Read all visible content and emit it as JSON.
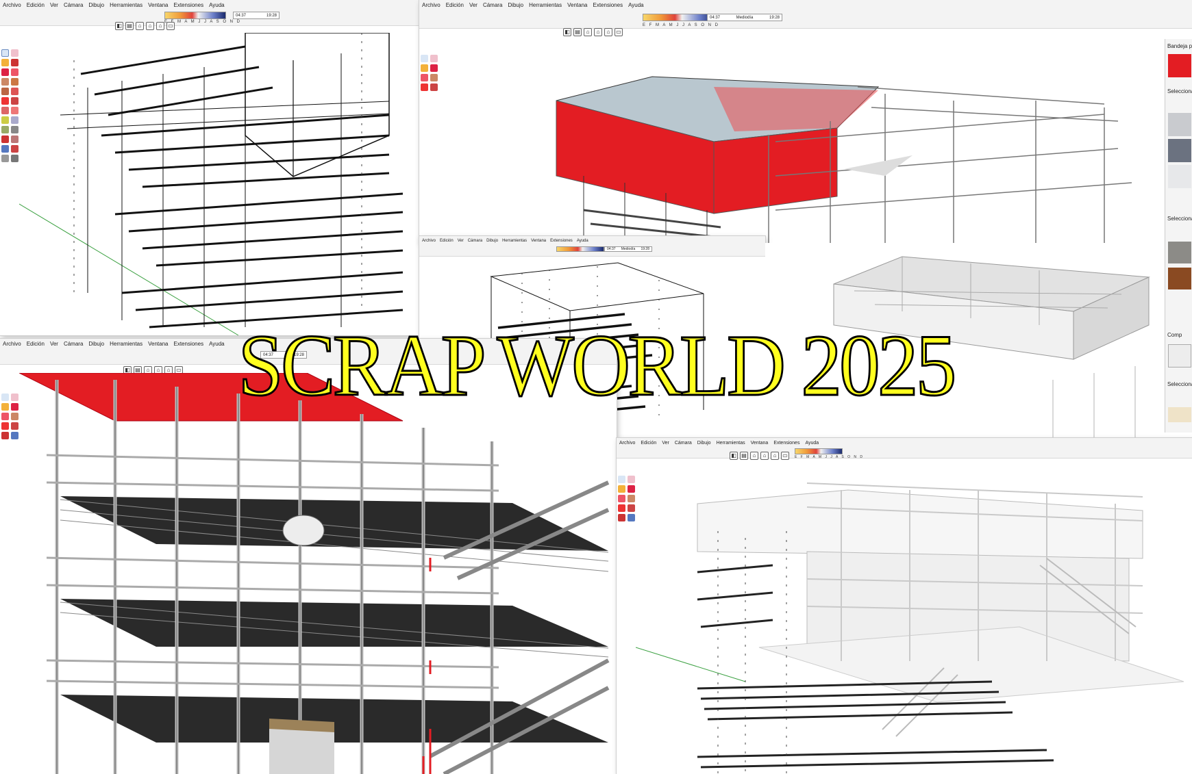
{
  "menu": [
    "Archivo",
    "Edición",
    "Ver",
    "Cámara",
    "Dibujo",
    "Herramientas",
    "Ventana",
    "Extensiones",
    "Ayuda"
  ],
  "shadow": {
    "months": "E F M A M J J A S O N D",
    "time_start": "04:37",
    "time_mid": "Mediodía",
    "time_end": "19:28",
    "time_mid_short": "Mediodía"
  },
  "tray": {
    "panel_title": "Bandeja pr",
    "section_1": "Selecciona",
    "section_2": "Selecciona",
    "section_3": "Comp",
    "section_4": "Selecciona"
  },
  "title": "SCRAP WORLD 2025",
  "colors": {
    "accent_red": "#e31d23",
    "title_fill": "#ffff1f",
    "title_stroke": "#000000",
    "axis_green": "#3aa040"
  },
  "icons": [
    "select-arrow-icon",
    "eraser-icon",
    "pencil-icon",
    "paint-bucket-icon",
    "orbit-icon",
    "pan-icon",
    "zoom-icon",
    "tape-measure-icon"
  ]
}
